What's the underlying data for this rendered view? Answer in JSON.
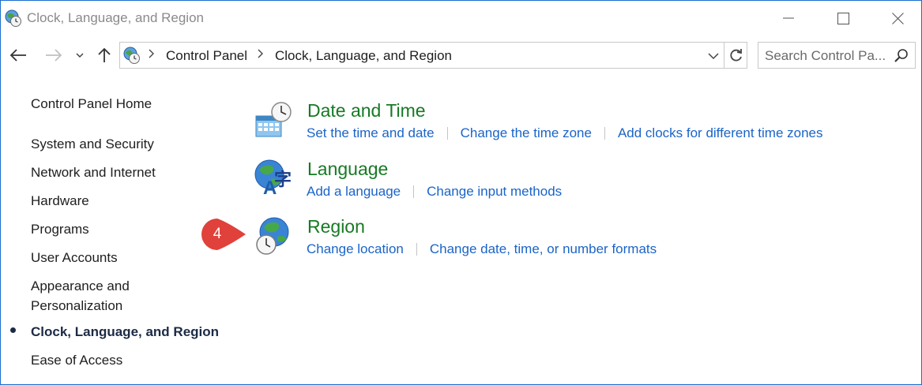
{
  "window": {
    "title": "Clock, Language, and Region",
    "accent": "#1a6fcf"
  },
  "address": {
    "breadcrumbs": [
      "Control Panel",
      "Clock, Language, and Region"
    ]
  },
  "search": {
    "placeholder": "Search Control Pa..."
  },
  "sidebar": {
    "home": "Control Panel Home",
    "items": [
      {
        "label": "System and Security",
        "current": false
      },
      {
        "label": "Network and Internet",
        "current": false
      },
      {
        "label": "Hardware",
        "current": false
      },
      {
        "label": "Programs",
        "current": false
      },
      {
        "label": "User Accounts",
        "current": false
      },
      {
        "label": "Appearance and",
        "label2": "Personalization",
        "current": false
      },
      {
        "label": "Clock, Language, and Region",
        "current": true
      },
      {
        "label": "Ease of Access",
        "current": false
      }
    ]
  },
  "categories": [
    {
      "title": "Date and Time",
      "icon": "calendar-clock-icon",
      "links": [
        "Set the time and date",
        "Change the time zone",
        "Add clocks for different time zones"
      ]
    },
    {
      "title": "Language",
      "icon": "globe-language-icon",
      "links": [
        "Add a language",
        "Change input methods"
      ]
    },
    {
      "title": "Region",
      "icon": "globe-clock-icon",
      "links": [
        "Change location",
        "Change date, time, or number formats"
      ]
    }
  ],
  "annotation": {
    "step_number": "4",
    "color": "#e0413a"
  },
  "colors": {
    "category_title": "#177a24",
    "link": "#1a64c8"
  }
}
